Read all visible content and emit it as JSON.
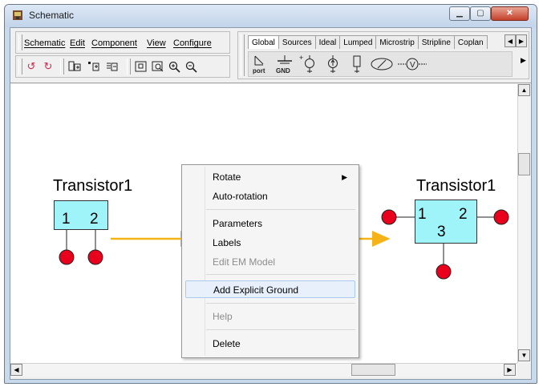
{
  "window": {
    "title": "Schematic",
    "controls": {
      "minimize": "▁",
      "maximize": "▢",
      "close": "✕"
    }
  },
  "menubar": {
    "items": [
      "Schematic",
      "Edit",
      "Component",
      "View",
      "Configure"
    ]
  },
  "toolbar": {
    "icons": [
      "undo-icon",
      "redo-icon",
      "copy-component-icon",
      "paste-component-icon",
      "duplicate-component-icon",
      "fit-view-icon",
      "zoom-area-icon",
      "zoom-in-icon",
      "zoom-out-icon"
    ]
  },
  "palette": {
    "tabs": [
      "Global",
      "Sources",
      "Ideal",
      "Lumped",
      "Microstrip",
      "Stripline",
      "Coplan"
    ],
    "active_tab": "Global",
    "items": [
      {
        "icon": "port-icon",
        "label": "port"
      },
      {
        "icon": "ground-icon",
        "label": "GND"
      },
      {
        "icon": "voltage-source-icon",
        "label": ""
      },
      {
        "icon": "current-source-icon",
        "label": ""
      },
      {
        "icon": "probe-icon",
        "label": ""
      },
      {
        "icon": "pattern-icon",
        "label": ""
      },
      {
        "icon": "voltmeter-icon",
        "label": ""
      }
    ]
  },
  "schematic": {
    "left_component": {
      "name": "Transistor1",
      "pins": [
        "1",
        "2"
      ]
    },
    "right_component": {
      "name": "Transistor1",
      "pins": [
        "1",
        "2",
        "3"
      ]
    },
    "colors": {
      "component_fill": "#9ef4f9",
      "pin_node": "#e8001c",
      "arrow": "#f5b317"
    }
  },
  "context_menu": {
    "items": [
      {
        "label": "Rotate",
        "submenu": true,
        "enabled": true
      },
      {
        "label": "Auto-rotation",
        "enabled": true
      },
      {
        "label": "Parameters",
        "enabled": true
      },
      {
        "label": "Labels",
        "enabled": true
      },
      {
        "label": "Edit EM Model",
        "enabled": false
      },
      {
        "label": "Add Explicit Ground",
        "enabled": true,
        "highlighted": true
      },
      {
        "label": "Help",
        "enabled": false
      },
      {
        "label": "Delete",
        "enabled": true
      }
    ]
  }
}
